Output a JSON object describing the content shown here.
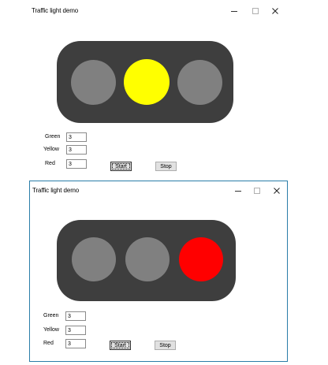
{
  "colors": {
    "housing": "#3e3e3e",
    "lamp_off": "#808080",
    "lamp_yellow": "#ffff00",
    "lamp_red": "#ff0000",
    "window_border": "#2a7da8"
  },
  "windows": [
    {
      "title": "Traffic light demo",
      "controls": {
        "minimize_icon": "minimize-icon",
        "maximize_icon": "maximize-icon",
        "close_icon": "close-icon"
      },
      "lamps": [
        {
          "name": "green",
          "state": "off",
          "color": "#808080"
        },
        {
          "name": "yellow",
          "state": "on",
          "color": "#ffff00"
        },
        {
          "name": "red",
          "state": "off",
          "color": "#808080"
        }
      ],
      "fields": {
        "green": {
          "label": "Green",
          "value": "3"
        },
        "yellow": {
          "label": "Yellow",
          "value": "3"
        },
        "red": {
          "label": "Red",
          "value": "3"
        }
      },
      "buttons": {
        "start": "Start",
        "stop": "Stop"
      }
    },
    {
      "title": "Traffic light demo",
      "controls": {
        "minimize_icon": "minimize-icon",
        "maximize_icon": "maximize-icon",
        "close_icon": "close-icon"
      },
      "lamps": [
        {
          "name": "green",
          "state": "off",
          "color": "#808080"
        },
        {
          "name": "yellow",
          "state": "off",
          "color": "#808080"
        },
        {
          "name": "red",
          "state": "on",
          "color": "#ff0000"
        }
      ],
      "fields": {
        "green": {
          "label": "Green",
          "value": "3"
        },
        "yellow": {
          "label": "Yellow",
          "value": "3"
        },
        "red": {
          "label": "Red",
          "value": "3"
        }
      },
      "buttons": {
        "start": "Start",
        "stop": "Stop"
      }
    }
  ]
}
